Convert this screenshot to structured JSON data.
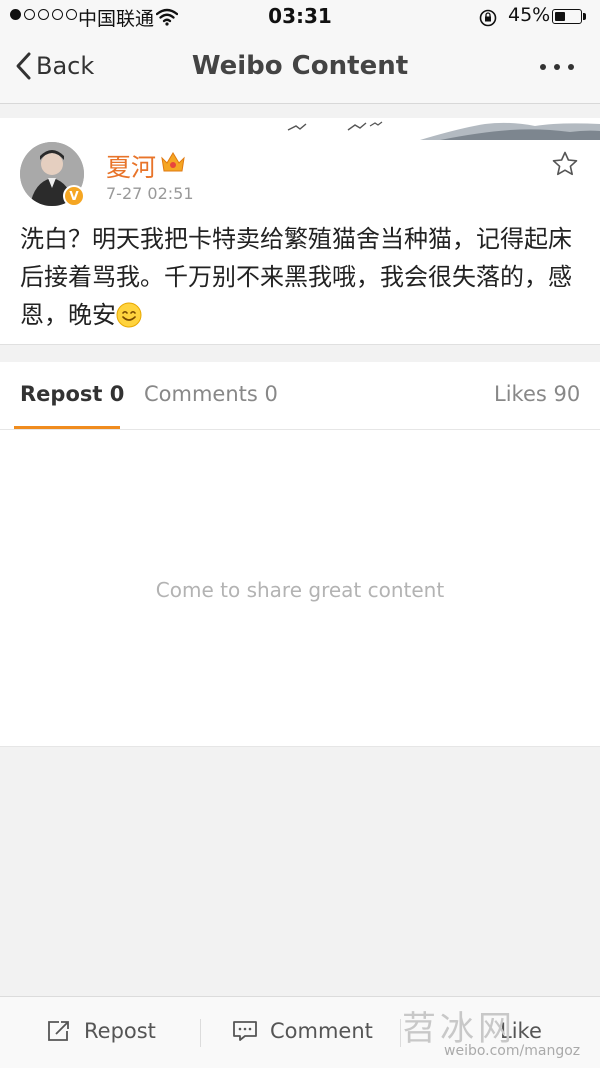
{
  "status_bar": {
    "carrier": "中国联通",
    "time": "03:31",
    "battery_percent": "45%",
    "battery_level": 0.45,
    "signal_bars_filled": 1,
    "signal_bars_total": 5
  },
  "nav": {
    "back_label": "Back",
    "title": "Weibo Content",
    "more_icon": "more-dots-icon"
  },
  "post": {
    "username": "夏河",
    "timestamp": "7-27 02:51",
    "verified_badge": "V",
    "text": "洗白？明天我把卡特卖给繁殖猫舍当种猫，记得起床后接着骂我。千万别不来黑我哦，我会很失落的，感恩，晚安",
    "emoji": "smile-emoji",
    "username_color": "#e8742a"
  },
  "tabs": {
    "repost": "Repost 0",
    "comments": "Comments 0",
    "likes": "Likes 90",
    "active": "repost",
    "accent_color": "#f08c1e"
  },
  "empty_state": {
    "message": "Come to share great content"
  },
  "bottom_bar": {
    "repost_label": "Repost",
    "comment_label": "Comment",
    "like_label": "Like",
    "watermark": "苕冰网",
    "watermark_url": "weibo.com/mangoz"
  }
}
